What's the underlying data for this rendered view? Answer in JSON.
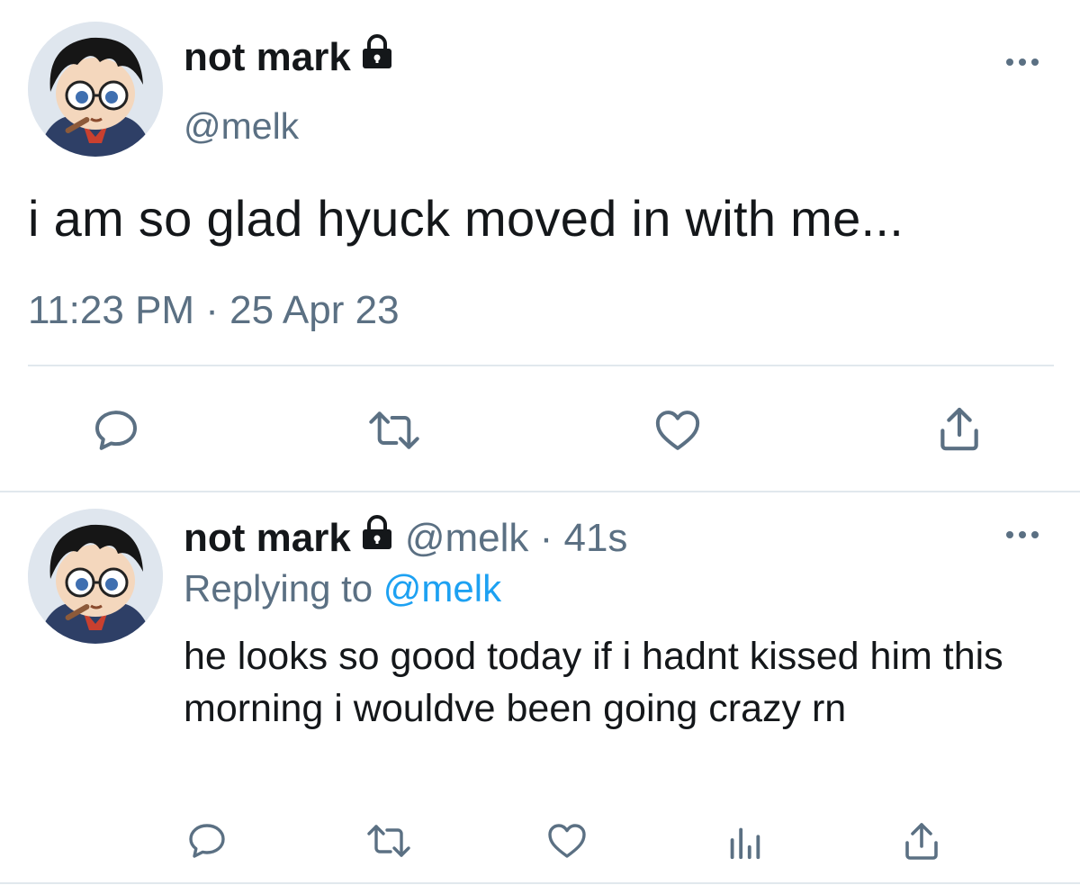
{
  "main_tweet": {
    "display_name": "not mark",
    "handle": "@melk",
    "text": "i am so glad hyuck moved in with me...",
    "timestamp": "11:23 PM · 25 Apr 23",
    "avatar_icon": "anime-avatar",
    "actions": [
      "reply-icon",
      "retweet-icon",
      "like-icon",
      "share-icon"
    ]
  },
  "reply_tweet": {
    "display_name": "not mark",
    "meta": "@melk · 41s",
    "replying_prefix": "Replying to",
    "replying_handle": "@melk",
    "text": "he looks so good today if i hadnt kissed him this morning i wouldve been going crazy rn",
    "avatar_icon": "anime-avatar",
    "actions": [
      "reply-icon",
      "retweet-icon",
      "like-icon",
      "analytics-icon",
      "share-icon"
    ]
  },
  "colors": {
    "text": "#14171a",
    "secondary": "#5b7083",
    "link": "#1da1f2",
    "divider": "#e1e8ed"
  }
}
